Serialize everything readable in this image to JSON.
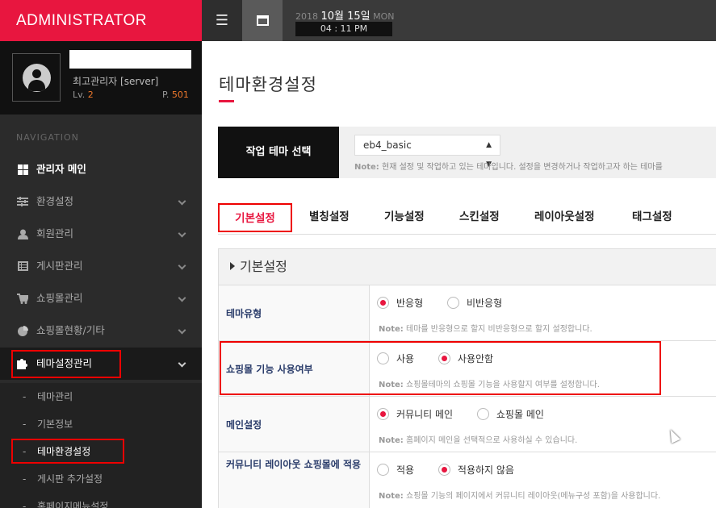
{
  "brand": "ADMINISTRATOR",
  "profile": {
    "name": "",
    "role": "최고관리자 [server]",
    "level_label": "Lv.",
    "level": "2",
    "point_label": "P.",
    "points": "501"
  },
  "nav": {
    "title": "NAVIGATION",
    "items": [
      {
        "label": "관리자 메인",
        "icon": "dashboard-icon"
      },
      {
        "label": "환경설정",
        "icon": "sliders-icon"
      },
      {
        "label": "회원관리",
        "icon": "user-icon"
      },
      {
        "label": "게시판관리",
        "icon": "list-icon"
      },
      {
        "label": "쇼핑몰관리",
        "icon": "cart-icon"
      },
      {
        "label": "쇼핑몰현황/기타",
        "icon": "pie-chart-icon"
      },
      {
        "label": "테마설정관리",
        "icon": "puzzle-icon"
      }
    ],
    "subitems": [
      "테마관리",
      "기본정보",
      "테마환경설정",
      "게시판 추가설정",
      "홈페이지메뉴설정"
    ]
  },
  "topbar": {
    "year": "2018",
    "date": "10월 15일",
    "weekday": "MON",
    "time": "04 : 11 PM"
  },
  "page": {
    "title": "테마환경설정"
  },
  "theme_select": {
    "label": "작업 테마 선택",
    "value": "eb4_basic",
    "note_label": "Note:",
    "note": "현재 설정 및 작업하고 있는 테마입니다. 설정을 변경하거나 작업하고자 하는 테마를"
  },
  "tabs": [
    "기본설정",
    "별칭설정",
    "기능설정",
    "스킨설정",
    "레이아웃설정",
    "태그설정"
  ],
  "section": {
    "title": "기본설정",
    "rows": [
      {
        "label": "테마유형",
        "options": [
          "반응형",
          "비반응형"
        ],
        "selected": 0,
        "note": "테마를 반응형으로 할지 비반응형으로 할지 설정합니다."
      },
      {
        "label": "쇼핑몰 기능 사용여부",
        "options": [
          "사용",
          "사용안함"
        ],
        "selected": 1,
        "note": "쇼핑몰테마의 쇼핑몰 기능을 사용할지 여부를 설정합니다."
      },
      {
        "label": "메인설정",
        "options": [
          "커뮤니티 메인",
          "쇼핑몰 메인"
        ],
        "selected": 0,
        "note": "홈페이지 메인을 선택적으로 사용하실 수 있습니다."
      },
      {
        "label": "커뮤니티 레이아웃 쇼핑몰에 적용",
        "options": [
          "적용",
          "적용하지 않음"
        ],
        "selected": 1,
        "note": "쇼핑몰 기능의 페이지에서 커뮤니티 레이아웃(메뉴구성 포함)을 사용합니다."
      }
    ],
    "note_label": "Note:"
  },
  "colors": {
    "accent": "#e8163f",
    "highlight_box": "#ee0000",
    "sidebar_bg": "#2b2b2b"
  }
}
